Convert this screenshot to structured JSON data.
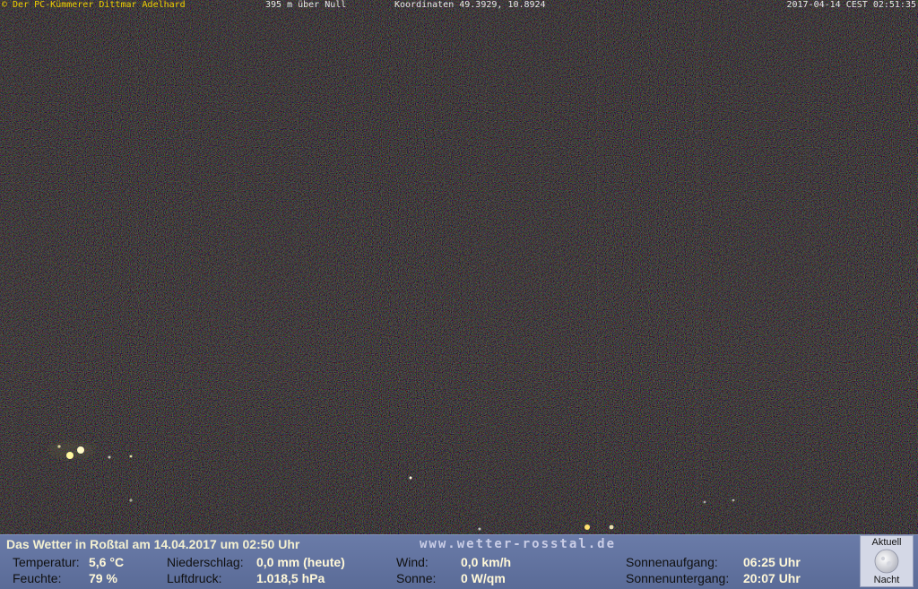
{
  "overlay": {
    "credit": "© Der PC-Kümmerer Dittmar Adelhard",
    "altitude": "395 m über Null",
    "coordinates": "Koordinaten 49.3929, 10.8924",
    "timestamp": "2017-04-14 CEST 02:51:35"
  },
  "weather": {
    "headline": "Das Wetter in Roßtal am 14.04.2017 um 02:50 Uhr",
    "website": "www.wetter-rosstal.de",
    "temperature_label": "Temperatur:",
    "temperature_value": "5,6 °C",
    "humidity_label": "Feuchte:",
    "humidity_value": "79 %",
    "precip_label": "Niederschlag:",
    "precip_value": "0,0 mm (heute)",
    "pressure_label": "Luftdruck:",
    "pressure_value": "1.018,5 hPa",
    "wind_label": "Wind:",
    "wind_value": "0,0 km/h",
    "sun_label": "Sonne:",
    "sun_value": "0 W/qm",
    "sunrise_label": "Sonnenaufgang:",
    "sunrise_value": "06:25 Uhr",
    "sunset_label": "Sonnenuntergang:",
    "sunset_value": "20:07 Uhr",
    "moon_top_label": "Aktuell",
    "moon_bottom_label": "Nacht"
  },
  "palette": {
    "sky": "#1e1c1b",
    "panel": "#5f70a0",
    "credit_text": "#f0d000"
  }
}
